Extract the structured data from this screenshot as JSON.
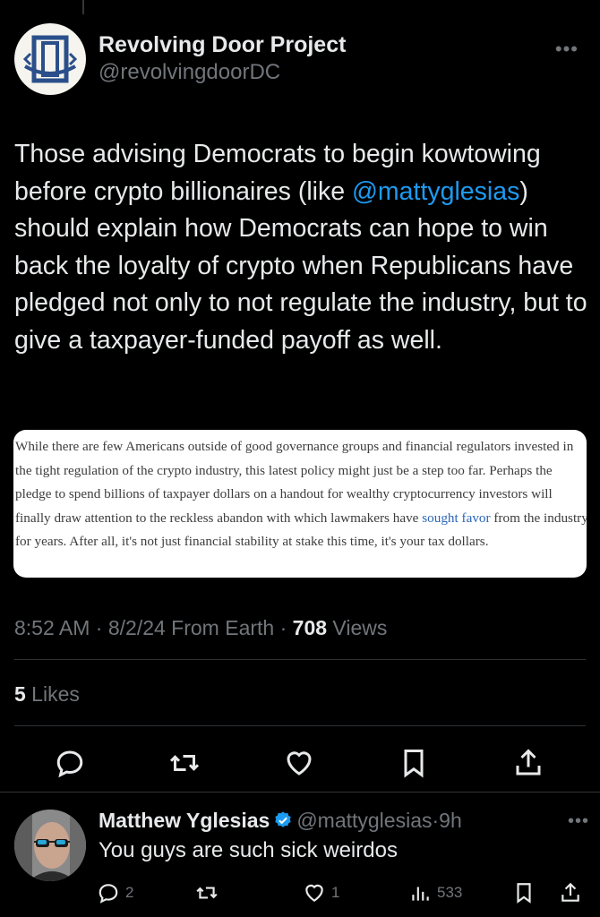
{
  "tweet": {
    "author_name": "Revolving Door Project",
    "author_handle": "@revolvingdoorDC",
    "text_before": "Those advising Democrats to begin kowtowing before crypto billionaires (like ",
    "mention": "@mattyglesias",
    "text_after": ") should explain how Democrats can hope to win back the loyalty of crypto when Republicans have pledged not only to not regulate the industry, but to give a taxpayer-funded payoff as well.",
    "quote_image_text_before": "While there are few Americans outside of good governance groups and financial regulators invested in the tight regulation of the crypto industry, this latest policy might just be a step too far. Perhaps the pledge to spend billions of taxpayer dollars on a handout for wealthy cryptocurrency investors will finally draw attention to the reckless abandon with which lawmakers have ",
    "quote_image_link": "sought favor",
    "quote_image_text_after": " from the industry for years. After all, it's not just financial stability at stake this time, it's your tax dollars.",
    "time": "8:52 AM",
    "sep1": " · ",
    "date": "8/2/24",
    "source": " From Earth",
    "sep2": " · ",
    "views_count": "708",
    "views_label": " Views",
    "likes_count": "5",
    "likes_label": " Likes",
    "more_icon": "more-horizontal-icon"
  },
  "actions": [
    "reply-icon",
    "retweet-icon",
    "like-icon",
    "bookmark-icon",
    "share-icon"
  ],
  "reply": {
    "name": "Matthew Yglesias",
    "handle": "@mattyglesias",
    "sep": "·",
    "time": "9h",
    "text": "You guys are such sick weirdos",
    "reply_count": "2",
    "like_count": "1",
    "views_count": "533"
  },
  "colors": {
    "background": "#000000",
    "text": "#e7e9ea",
    "secondary": "#71767b",
    "accent": "#1d9bf0",
    "logo_blue": "#2a4f8a"
  }
}
